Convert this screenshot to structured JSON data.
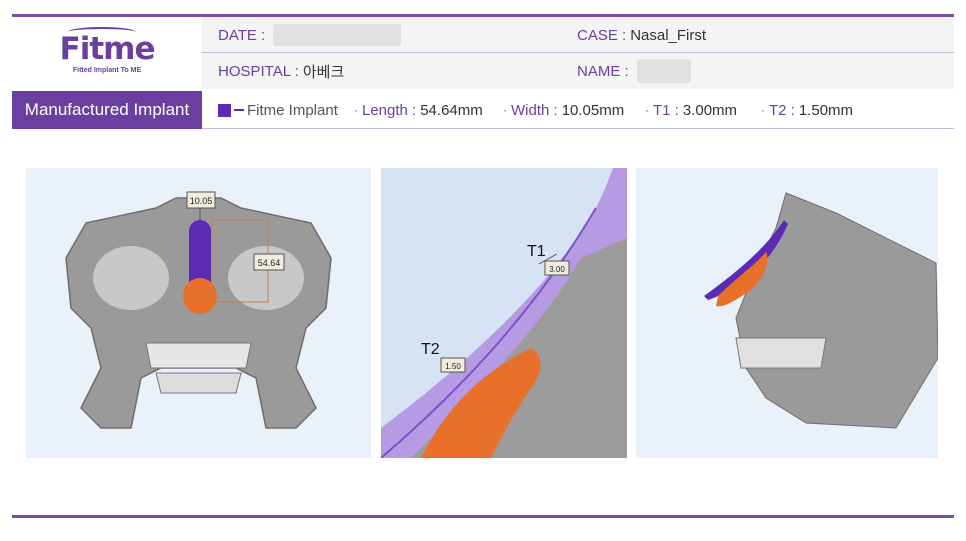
{
  "header": {
    "logo_text": "Fitme",
    "logo_tagline": "Fitted Implant To ME",
    "date_label": "DATE :",
    "case_label": "CASE :",
    "case_value": "Nasal_First",
    "hospital_label": "HOSPITAL :",
    "hospital_value": "아베크",
    "name_label": "NAME :"
  },
  "implant": {
    "section_label": "Manufactured Implant",
    "legend_label": "Fitme Implant",
    "length_label": "Length :",
    "length_value": "54.64mm",
    "width_label": "Width :",
    "width_value": "10.05mm",
    "t1_label": "T1 :",
    "t1_value": "3.00mm",
    "t2_label": "T2 :",
    "t2_value": "1.50mm",
    "bullet": "·"
  },
  "figures": {
    "front": {
      "width_tag": "10.05",
      "length_tag": "54.64"
    },
    "closeup": {
      "t1_label": "T1",
      "t1_tag": "3.00",
      "t2_label": "T2",
      "t2_tag": "1.50"
    }
  },
  "colors": {
    "brand_purple": "#6b3fa0",
    "implant_purple": "#5b2bb5",
    "implant_orange": "#e8702a",
    "panel_bg": "#e9f1fa"
  }
}
